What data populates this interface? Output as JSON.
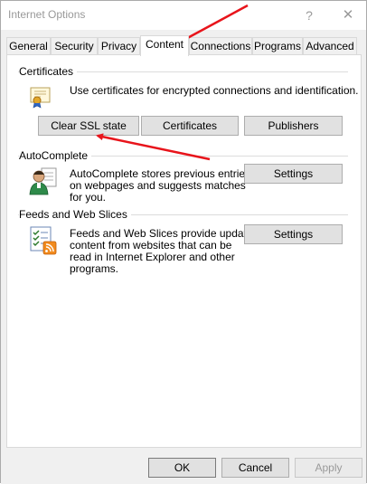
{
  "window": {
    "title": "Internet Options",
    "help_glyph": "?",
    "close_glyph": "✕"
  },
  "tabs": [
    {
      "label": "General",
      "active": false
    },
    {
      "label": "Security",
      "active": false
    },
    {
      "label": "Privacy",
      "active": false
    },
    {
      "label": "Content",
      "active": true
    },
    {
      "label": "Connections",
      "active": false
    },
    {
      "label": "Programs",
      "active": false
    },
    {
      "label": "Advanced",
      "active": false
    }
  ],
  "certificates": {
    "heading": "Certificates",
    "description": "Use certificates for encrypted connections and identification.",
    "clear_ssl_label": "Clear SSL state",
    "certificates_label": "Certificates",
    "publishers_label": "Publishers",
    "icon": "certificate-icon"
  },
  "autocomplete": {
    "heading": "AutoComplete",
    "description_lines": [
      "AutoComplete stores previous entries",
      "on webpages and suggests matches",
      "for you."
    ],
    "settings_label": "Settings",
    "icon": "autocomplete-user-icon"
  },
  "feeds": {
    "heading": "Feeds and Web Slices",
    "description_lines": [
      "Feeds and Web Slices provide updated",
      "content from websites that can be",
      "read in Internet Explorer and other",
      "programs."
    ],
    "settings_label": "Settings",
    "icon": "feeds-rss-icon"
  },
  "footer": {
    "ok_label": "OK",
    "cancel_label": "Cancel",
    "apply_label": "Apply",
    "apply_enabled": false
  },
  "annotation_color": "#e8141b"
}
